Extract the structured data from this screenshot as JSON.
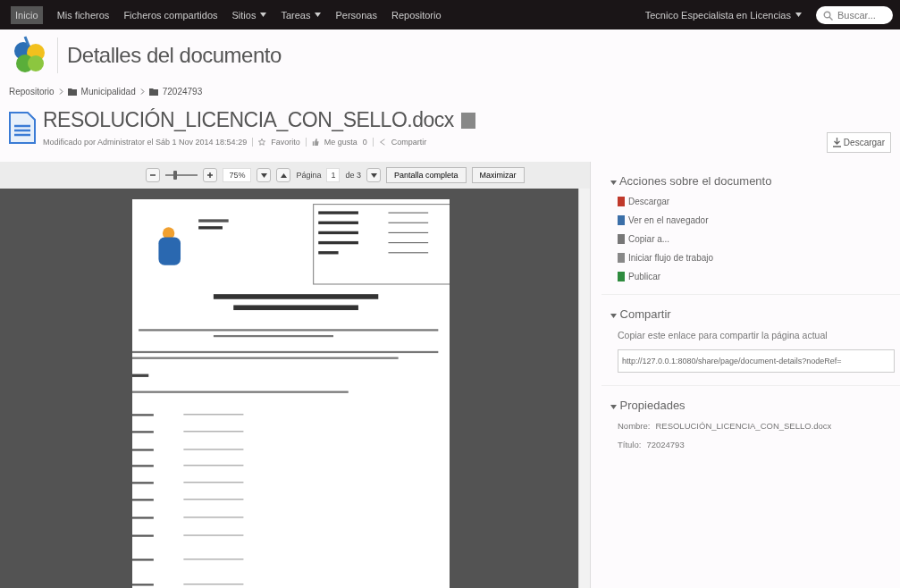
{
  "nav": {
    "items": [
      {
        "label": "Inicio",
        "selected": true,
        "dropdown": false
      },
      {
        "label": "Mis ficheros",
        "selected": false,
        "dropdown": false
      },
      {
        "label": "Ficheros compartidos",
        "selected": false,
        "dropdown": false
      },
      {
        "label": "Sitios",
        "selected": false,
        "dropdown": true
      },
      {
        "label": "Tareas",
        "selected": false,
        "dropdown": true
      },
      {
        "label": "Personas",
        "selected": false,
        "dropdown": false
      },
      {
        "label": "Repositorio",
        "selected": false,
        "dropdown": false
      }
    ],
    "user": "Tecnico Especialista en Licencias",
    "search": {
      "placeholder": "Buscar..."
    }
  },
  "header": {
    "title": "Detalles del documento"
  },
  "breadcrumb": [
    "Repositorio",
    "Municipalidad",
    "72024793"
  ],
  "document": {
    "name": "RESOLUCIÓN_LICENCIA_CON_SELLO.docx",
    "modified": "Modificado por Administrator el Sáb 1 Nov 2014 18:54:29",
    "favorite": "Favorito",
    "like": "Me gusta",
    "likes": "0",
    "share": "Compartir",
    "download": "Descargar"
  },
  "viewer": {
    "zoom_slider": {
      "level": 0.3
    },
    "zoom": "75%",
    "page_label": "Página",
    "page": "1",
    "page_total": "de 3",
    "fullscreen": "Pantalla completa",
    "maximize": "Maximizar"
  },
  "actions": {
    "title": "Acciones sobre el documento",
    "items": [
      {
        "label": "Descargar",
        "kind": "download"
      },
      {
        "label": "Ver en el navegador",
        "kind": "view"
      },
      {
        "label": "Copiar a...",
        "kind": "copy"
      },
      {
        "label": "Iniciar flujo de trabajo",
        "kind": "workflow"
      },
      {
        "label": "Publicar",
        "kind": "publish"
      }
    ]
  },
  "share": {
    "title": "Compartir",
    "hint": "Copiar este enlace para compartir la página actual",
    "link": "http://127.0.0.1:8080/share/page/document-details?nodeRef="
  },
  "properties": {
    "title": "Propiedades",
    "items": [
      {
        "label": "Nombre:",
        "value": "RESOLUCIÓN_LICENCIA_CON_SELLO.docx"
      },
      {
        "label": "Título:",
        "value": "72024793"
      }
    ]
  }
}
